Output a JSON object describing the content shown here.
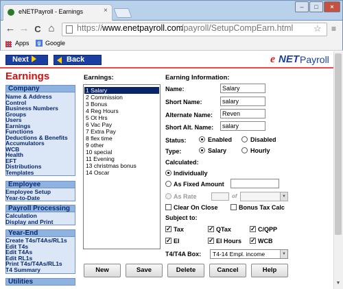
{
  "browser": {
    "tab_title": "eNETPayroll - Earnings",
    "tab_close": "×",
    "win_min": "–",
    "win_max": "□",
    "win_close": "×",
    "back_arrow": "←",
    "forward_arrow": "→",
    "reload": "C",
    "home": "⌂",
    "url_protocol": "https://",
    "url_host": "www.enetpayroll.com",
    "url_path": "/payroll/SetupCompEarn.html",
    "star": "☆",
    "menu": "≡",
    "bookmarks": [
      {
        "label": "Apps",
        "icon": "apps-grid-icon"
      },
      {
        "label": "Google",
        "icon": "google-icon"
      }
    ],
    "google_letter": "g"
  },
  "header": {
    "next_label": "Next",
    "back_label": "Back",
    "logo_e": "e",
    "logo_net": "NET",
    "logo_payroll": "Payroll",
    "accent_color": "#cc1111",
    "brand_color": "#1a3fa0"
  },
  "sidebar": {
    "page_title": "Earnings",
    "sections": [
      {
        "title": "Company",
        "links": [
          "Name & Address",
          "Control",
          "Business Numbers",
          "Groups",
          "Users",
          "Earnings",
          "Functions",
          "Deductions & Benefits",
          "Accumulators",
          "WCB",
          "Health",
          "EFT",
          "Distributions",
          "Templates"
        ]
      },
      {
        "title": "Employee",
        "links": [
          "Employee Setup",
          "Year-to-Date"
        ]
      },
      {
        "title": "Payroll Processing",
        "links": [
          "Calculation",
          "Display and Print"
        ]
      },
      {
        "title": "Year-End",
        "links": [
          "Create T4s/T4As/RL1s",
          "Edit T4s",
          "Edit T4As",
          "Edit RL1s",
          "Print T4s/T4As/RL1s",
          "T4 Summary"
        ]
      },
      {
        "title": "Utilities",
        "links": []
      }
    ]
  },
  "earnings_list": {
    "label": "Earnings:",
    "items": [
      "1 Salary",
      "2 Commission",
      "3 Bonus",
      "4 Reg Hours",
      "5 Ot Hrs",
      "6 Vac Pay",
      "7 Extra Pay",
      "8 flex time",
      "9 other",
      "10 special",
      "11 Evening",
      "13 christmas bonus",
      "14 Oscar"
    ],
    "selected_index": 0
  },
  "info": {
    "label": "Earning Information:",
    "name_label": "Name:",
    "name_value": "Salary",
    "short_name_label": "Short Name:",
    "short_name_value": "salary",
    "alt_name_label": "Alternate Name:",
    "alt_name_value": "Reven",
    "short_alt_label": "Short Alt. Name:",
    "short_alt_value": "salary",
    "status_label": "Status:",
    "status_enabled": "Enabled",
    "status_disabled": "Disabled",
    "type_label": "Type:",
    "type_salary": "Salary",
    "type_hourly": "Hourly",
    "calculated_label": "Calculated:",
    "calc_individually": "Individually",
    "calc_fixed": "As Fixed Amount",
    "calc_rate": "As Rate",
    "of_label": "of",
    "clear_on_close": "Clear On Close",
    "bonus_tax_calc": "Bonus Tax Calc",
    "subject_label": "Subject to:",
    "tax": "Tax",
    "qtax": "QTax",
    "cqpp": "C/QPP",
    "ei": "EI",
    "ei_hours": "EI Hours",
    "wcb": "WCB",
    "check_mark": "✓",
    "t4_label": "T4/T4A Box:",
    "t4_value": "T4-14  Empl. income"
  },
  "buttons": {
    "new": "New",
    "save": "Save",
    "delete": "Delete",
    "cancel": "Cancel",
    "help": "Help"
  }
}
